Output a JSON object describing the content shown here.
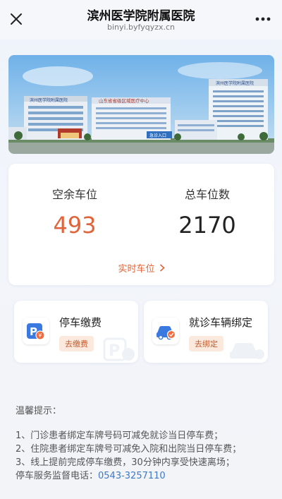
{
  "header": {
    "title": "滨州医学院附属医院",
    "subtitle": "binyi.byfyqyzx.cn",
    "close_icon": "close-icon",
    "more_icon": "more-dots-icon"
  },
  "banner": {
    "sign_left": "滨州医学院附属医院",
    "sign_center": "山东省省级区域医疗中心",
    "sign_right": "滨州医学院附属医院",
    "sign_door": "急诊入口"
  },
  "stats": {
    "available_label": "空余车位",
    "available_value": "493",
    "total_label": "总车位数",
    "total_value": "2170",
    "realtime_label": "实时车位",
    "accent_color": "#e0643a"
  },
  "actions": [
    {
      "title": "停车缴费",
      "button": "去缴费",
      "icon": "parking-payment-icon"
    },
    {
      "title": "就诊车辆绑定",
      "button": "去绑定",
      "icon": "car-binding-icon"
    }
  ],
  "notes": {
    "title": "温馨提示：",
    "items": [
      "1、门诊患者绑定车牌号码可减免就诊当日停车费；",
      "2、住院患者绑定车牌号可减免入院和出院当日停车费；",
      "3、线上提前完成停车缴费，30分钟内享受快速离场；"
    ],
    "phone_label": "停车服务监督电话：",
    "phone_number": "0543-3257110",
    "link_color": "#3e78c8"
  }
}
